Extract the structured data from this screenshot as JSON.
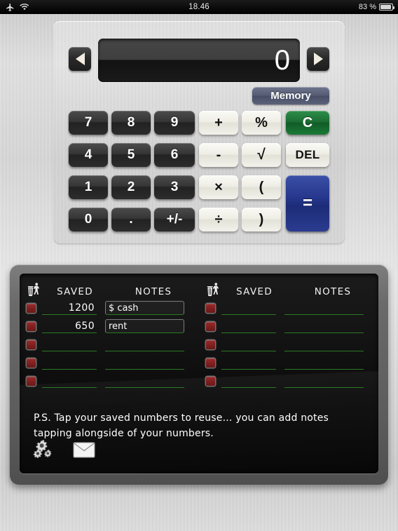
{
  "statusbar": {
    "airplane_icon": "airplane-icon",
    "wifi_icon": "wifi-icon",
    "time": "18.46",
    "battery_percent": "83 %",
    "battery_level": 83
  },
  "calculator": {
    "display_value": "0",
    "prev_label": "◀",
    "next_label": "▶",
    "memory_label": "Memory",
    "keys": [
      {
        "label": "7",
        "name": "key-7",
        "style": "dark",
        "col": 0,
        "row": 0
      },
      {
        "label": "8",
        "name": "key-8",
        "style": "dark",
        "col": 1,
        "row": 0
      },
      {
        "label": "9",
        "name": "key-9",
        "style": "dark",
        "col": 2,
        "row": 0
      },
      {
        "label": "+",
        "name": "key-plus",
        "style": "light",
        "col": 3,
        "row": 0
      },
      {
        "label": "%",
        "name": "key-percent",
        "style": "light",
        "col": 4,
        "row": 0
      },
      {
        "label": "C",
        "name": "key-clear",
        "style": "green",
        "col": 5,
        "row": 0
      },
      {
        "label": "4",
        "name": "key-4",
        "style": "dark",
        "col": 0,
        "row": 1
      },
      {
        "label": "5",
        "name": "key-5",
        "style": "dark",
        "col": 1,
        "row": 1
      },
      {
        "label": "6",
        "name": "key-6",
        "style": "dark",
        "col": 2,
        "row": 1
      },
      {
        "label": "-",
        "name": "key-minus",
        "style": "light",
        "col": 3,
        "row": 1
      },
      {
        "label": "√",
        "name": "key-sqrt",
        "style": "light",
        "col": 4,
        "row": 1
      },
      {
        "label": "DEL",
        "name": "key-delete",
        "style": "light",
        "col": 5,
        "row": 1
      },
      {
        "label": "1",
        "name": "key-1",
        "style": "dark",
        "col": 0,
        "row": 2
      },
      {
        "label": "2",
        "name": "key-2",
        "style": "dark",
        "col": 1,
        "row": 2
      },
      {
        "label": "3",
        "name": "key-3",
        "style": "dark",
        "col": 2,
        "row": 2
      },
      {
        "label": "×",
        "name": "key-multiply",
        "style": "light",
        "col": 3,
        "row": 2
      },
      {
        "label": "(",
        "name": "key-paren-open",
        "style": "light",
        "col": 4,
        "row": 2
      },
      {
        "label": "=",
        "name": "key-equals",
        "style": "blue",
        "col": 5,
        "row": 2,
        "tall": true
      },
      {
        "label": "0",
        "name": "key-0",
        "style": "dark",
        "col": 0,
        "row": 3
      },
      {
        "label": ".",
        "name": "key-decimal",
        "style": "dark",
        "col": 1,
        "row": 3
      },
      {
        "label": "+/-",
        "name": "key-sign",
        "style": "dark",
        "col": 2,
        "row": 3
      },
      {
        "label": "÷",
        "name": "key-divide",
        "style": "light",
        "col": 3,
        "row": 3
      },
      {
        "label": ")",
        "name": "key-paren-close",
        "style": "light",
        "col": 4,
        "row": 3
      }
    ]
  },
  "notes_panel": {
    "trash_icon": "trash-icon",
    "header_saved": "SAVED",
    "header_notes": "NOTES",
    "ps_text": "P.S. Tap your saved numbers to reuse... you can add notes tapping alongside of your numbers.",
    "settings_icon": "gears-icon",
    "mail_icon": "envelope-icon",
    "left_column": [
      {
        "saved": "1200",
        "note": "$ cash",
        "note_filled": true
      },
      {
        "saved": "650",
        "note": "rent",
        "note_filled": true
      },
      {
        "saved": "",
        "note": "",
        "note_filled": false
      },
      {
        "saved": "",
        "note": "",
        "note_filled": false
      },
      {
        "saved": "",
        "note": "",
        "note_filled": false
      }
    ],
    "right_column": [
      {
        "saved": "",
        "note": "",
        "note_filled": false
      },
      {
        "saved": "",
        "note": "",
        "note_filled": false
      },
      {
        "saved": "",
        "note": "",
        "note_filled": false
      },
      {
        "saved": "",
        "note": "",
        "note_filled": false
      },
      {
        "saved": "",
        "note": "",
        "note_filled": false
      }
    ]
  },
  "colors": {
    "accent_equals": "#26378c",
    "accent_clear": "#1d6d34",
    "memory_button": "#555c74",
    "row_underline": "#2a7a24",
    "checkbox": "#7d1e1e"
  }
}
